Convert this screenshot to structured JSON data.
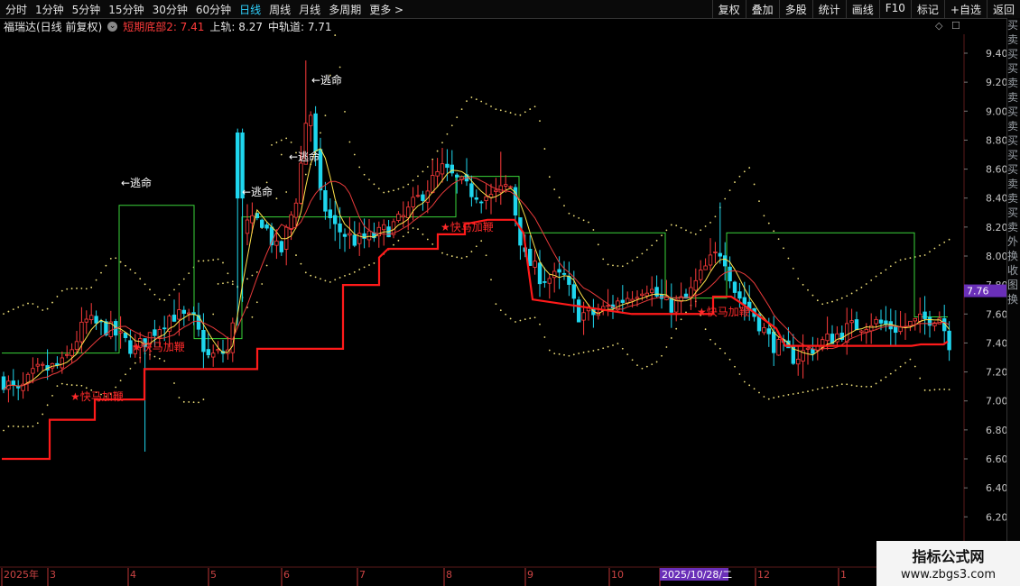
{
  "toolbar": {
    "tabs": [
      "分时",
      "1分钟",
      "5分钟",
      "15分钟",
      "30分钟",
      "60分钟",
      "日线",
      "周线",
      "月线",
      "多周期",
      "更多"
    ],
    "active_tab": "日线",
    "more_arrow": ">",
    "buttons": [
      "复权",
      "叠加",
      "多股",
      "统计",
      "画线",
      "F10",
      "标记",
      "+自选",
      "返回"
    ]
  },
  "info": {
    "stock_title": "福瑞达(日线 前复权)",
    "indicator_label": "短期底部2: 7.41",
    "upper_label": "上轨: 8.27",
    "mid_label": "中轨道: 7.71"
  },
  "axis": {
    "price_labels": [
      "9.40",
      "9.20",
      "9.00",
      "8.80",
      "8.60",
      "8.40",
      "8.20",
      "8.00",
      "7.80",
      "7.60",
      "7.40",
      "7.20",
      "7.00",
      "6.80",
      "6.60",
      "6.40",
      "6.20"
    ],
    "current_price": "7.76",
    "dates": [
      "2025年",
      "3",
      "4",
      "5",
      "6",
      "7",
      "8",
      "9",
      "10",
      "2025/10/28/二",
      "12",
      "1"
    ]
  },
  "annotations": {
    "escape": "←逃命",
    "buy": "★快马加鞭"
  },
  "side_panel": [
    "买",
    "卖",
    "买",
    "买",
    "卖",
    "卖",
    "买",
    "卖",
    "买",
    "买",
    "买",
    "卖",
    "卖",
    "买",
    "卖",
    "外",
    "换",
    "收",
    "图",
    "换"
  ],
  "watermark": {
    "line1": "指标公式网",
    "line2": "www.zbgs3.com"
  },
  "colors": {
    "up": "#ff3b3b",
    "down": "#1fd6ee",
    "bottom_line": "#ff1a1a",
    "upper_band": "#3ad43a",
    "ma_yellow": "#ffe24a",
    "ma_red": "#e83a3a",
    "dots": "#f0e07a",
    "current_price_bg": "#6a2fb8"
  }
}
